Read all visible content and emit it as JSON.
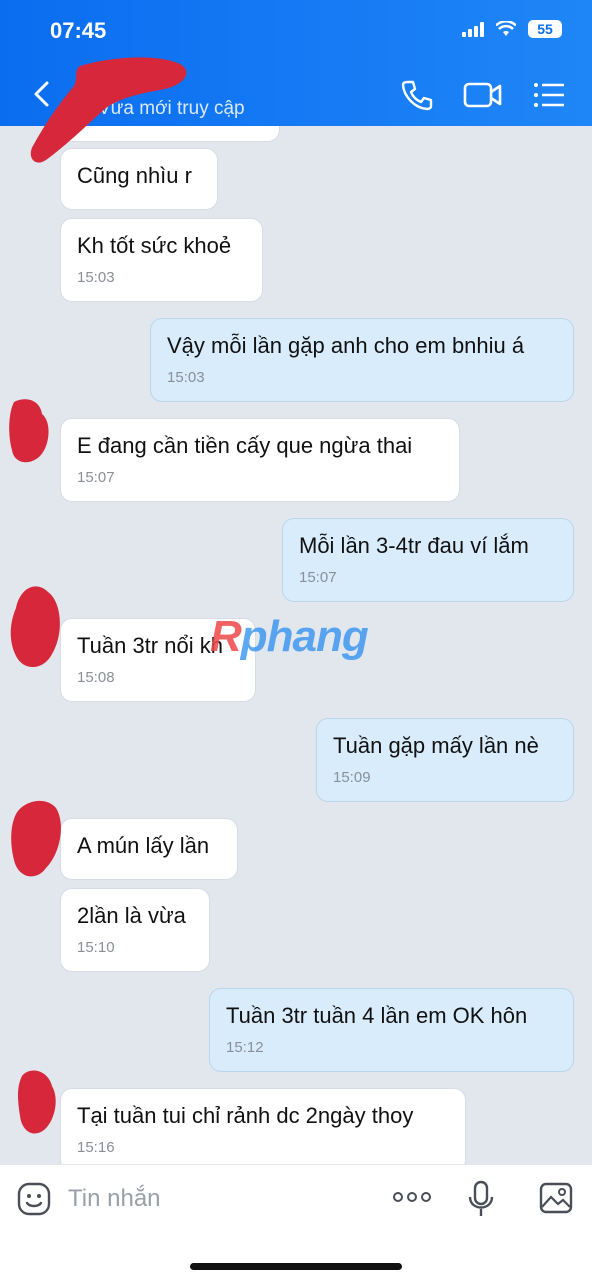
{
  "status": {
    "time": "07:45",
    "battery": "55"
  },
  "header": {
    "subtitle": "Vừa mới truy cập"
  },
  "messages": [
    {
      "dir": "in",
      "text": "Cũng nhìu r",
      "time": ""
    },
    {
      "dir": "in",
      "text": "Kh tốt sức khoẻ",
      "time": "15:03"
    },
    {
      "dir": "out",
      "text": "Vậy mỗi lần gặp anh cho em bnhiu á",
      "time": "15:03"
    },
    {
      "dir": "in",
      "text": "E đang cần tiền cấy que ngừa thai",
      "time": "15:07"
    },
    {
      "dir": "out",
      "text": "Mỗi lần 3-4tr đau ví lắm",
      "time": "15:07"
    },
    {
      "dir": "in",
      "text": "Tuần 3tr nổi kh",
      "time": "15:08"
    },
    {
      "dir": "out",
      "text": "Tuần gặp mấy lần nè",
      "time": "15:09"
    },
    {
      "dir": "in",
      "text": "A mún lấy lần",
      "time": ""
    },
    {
      "dir": "in",
      "text": "2lần là vừa",
      "time": "15:10"
    },
    {
      "dir": "out",
      "text": "Tuần 3tr tuần 4 lần em OK hôn",
      "time": "15:12"
    },
    {
      "dir": "in",
      "text": "Tại tuần tui chỉ rảnh dc 2ngày thoy",
      "time": "15:16"
    }
  ],
  "watermark": {
    "first": "R",
    "rest": "phang"
  },
  "input": {
    "placeholder": "Tin nhắn"
  },
  "icons": [
    "back-icon",
    "phone-icon",
    "video-icon",
    "menu-icon",
    "emoji-icon",
    "more-icon",
    "mic-icon",
    "image-icon"
  ],
  "colors": {
    "header": "#0a6df0",
    "outgoing": "#d9ecfb",
    "incoming": "#ffffff",
    "redaction": "#d6283a"
  }
}
